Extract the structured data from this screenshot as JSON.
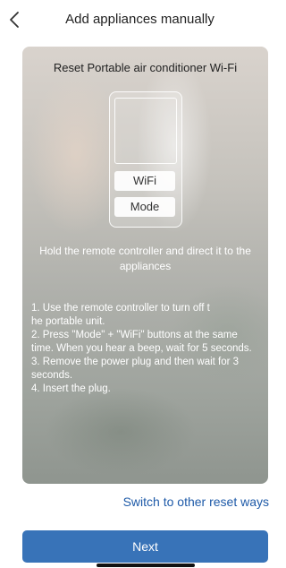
{
  "header": {
    "back_icon": "chevron-left-icon",
    "title": "Add appliances manually"
  },
  "card": {
    "title": "Reset Portable air conditioner Wi-Fi",
    "remote": {
      "wifi_label": "WiFi",
      "mode_label": "Mode"
    },
    "hint": "Hold the remote controller and direct it to the appliances",
    "steps": "1. Use the remote controller to turn off t\nhe portable unit.\n2. Press \"Mode\" + \"WiFi\" buttons at the same time. When you hear a beep, wait for 5 seconds.\n3. Remove the power plug and then wait for 3 seconds.\n4. Insert the plug."
  },
  "alt_link": "Switch to other reset ways",
  "next_button": "Next",
  "colors": {
    "accent": "#3873b8",
    "link": "#1e5aa8"
  }
}
